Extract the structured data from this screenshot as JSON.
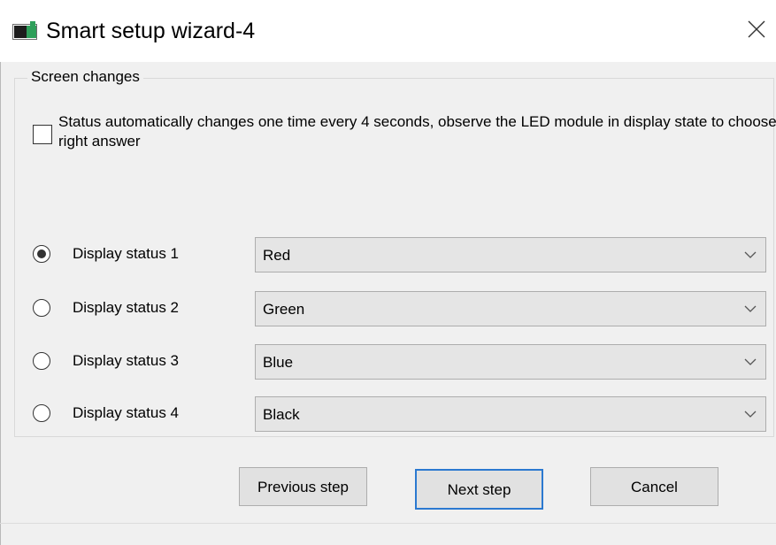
{
  "window": {
    "title": "Smart setup wizard-4",
    "icons": {
      "app": "app-window-icon",
      "close": "close-icon"
    }
  },
  "group": {
    "legend": "Screen changes",
    "checkbox": {
      "label": "Status automatically changes one time every 4 seconds, observe the LED module in display state to choose right answer",
      "checked": false
    },
    "statuses": [
      {
        "label": "Display status 1",
        "value": "Red",
        "selected": true
      },
      {
        "label": "Display status 2",
        "value": "Green",
        "selected": false
      },
      {
        "label": "Display status 3",
        "value": "Blue",
        "selected": false
      },
      {
        "label": "Display status 4",
        "value": "Black",
        "selected": false
      }
    ]
  },
  "buttons": {
    "previous": "Previous step",
    "next": "Next step",
    "cancel": "Cancel"
  },
  "colors": {
    "focus_border": "#2b79d0",
    "window_bg": "#f0f0f0"
  }
}
